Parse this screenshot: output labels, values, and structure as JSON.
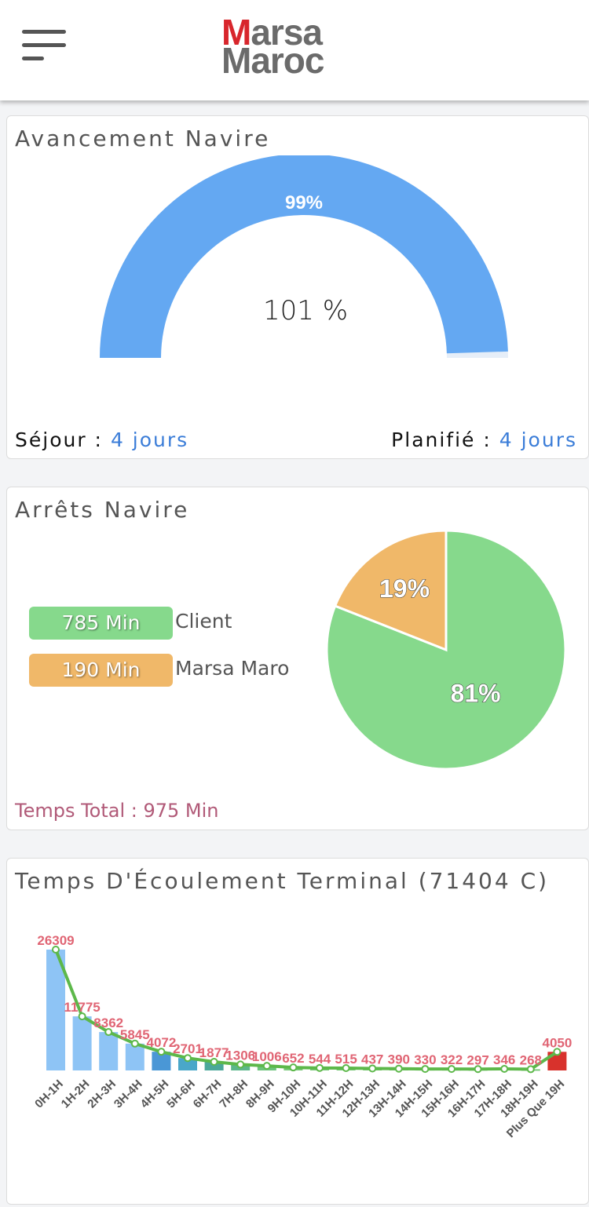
{
  "header": {
    "logo_line1_first": "M",
    "logo_line1_rest": "arsa",
    "logo_line2": "Maroc"
  },
  "avancement": {
    "title": "Avancement Navire",
    "gauge_label": "99%",
    "center_text": "101 %",
    "progress_fraction": 0.99,
    "sejour_label": "Séjour : ",
    "sejour_value": "4 jours",
    "planifie_label": "Planifié : ",
    "planifie_value": "4 jours",
    "color": "#64a8f2"
  },
  "arrets": {
    "title": "Arrêts Navire",
    "legend": [
      {
        "value": "785 Min",
        "label": "Client",
        "color": "#86d98c"
      },
      {
        "value": "190 Min",
        "label": "Marsa Maro",
        "color": "#f0b869"
      }
    ],
    "total": "Temps Total : 975 Min",
    "pie": {
      "slices": [
        {
          "value": 81,
          "label": "81%",
          "color": "#86d98c"
        },
        {
          "value": 19,
          "label": "19%",
          "color": "#f0b869"
        }
      ]
    }
  },
  "ecoulement": {
    "title": "Temps D'Écoulement Terminal (71404 C)"
  },
  "chart_data": {
    "type": "bar",
    "title": "Temps D'Écoulement Terminal (71404 C)",
    "categories": [
      "0H-1H",
      "1H-2H",
      "2H-3H",
      "3H-4H",
      "4H-5H",
      "5H-6H",
      "6H-7H",
      "7H-8H",
      "8H-9H",
      "9H-10H",
      "10H-11H",
      "11H-12H",
      "12H-13H",
      "13H-14H",
      "14H-15H",
      "15H-16H",
      "16H-17H",
      "17H-18H",
      "18H-19H",
      "Plus Que 19H"
    ],
    "values": [
      26309,
      11775,
      8362,
      5845,
      4072,
      2701,
      1877,
      1306,
      1006,
      652,
      544,
      515,
      437,
      390,
      330,
      322,
      297,
      346,
      268,
      4050
    ],
    "value_labels": [
      "26309",
      "11775",
      "8362",
      "5845",
      "4072",
      "2701",
      "1877",
      "1306",
      "1006",
      "652",
      "544",
      "515",
      "437",
      "390",
      "330",
      "322",
      "297",
      "346",
      "268",
      "4050"
    ],
    "bar_colors": [
      "#8ec4f5",
      "#8ec4f5",
      "#8ec4f5",
      "#8ec4f5",
      "#4a97d6",
      "#4aa7c9",
      "#4ba89a",
      "#5bb78a",
      "#6cc47c",
      "#7ac97a",
      "#7ac97a",
      "#7ac97a",
      "#7ac97a",
      "#7ac97a",
      "#7ac97a",
      "#7ac97a",
      "#7ac97a",
      "#7ac97a",
      "#7ac97a",
      "#d8322c"
    ],
    "line_color": "#5db84a",
    "label_color": "#e06574"
  }
}
